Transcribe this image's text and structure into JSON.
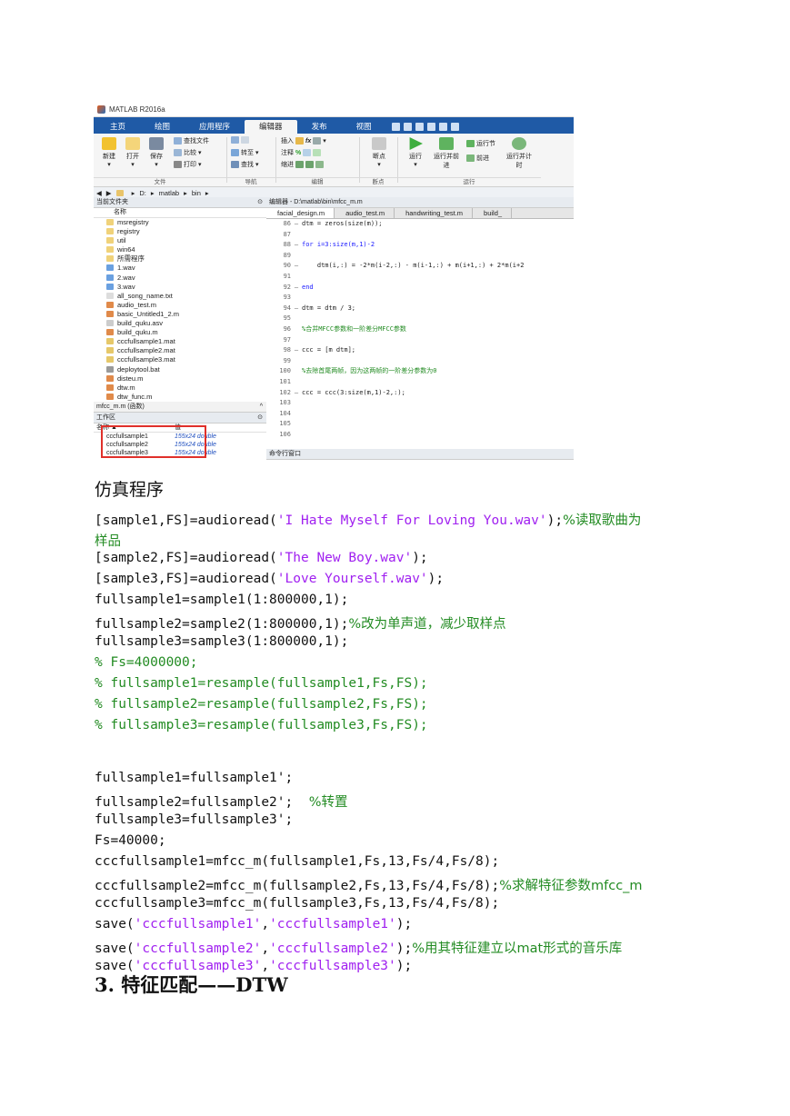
{
  "matlab": {
    "window_title": "MATLAB R2016a",
    "tabs": [
      "主页",
      "绘图",
      "应用程序",
      "编辑器",
      "发布",
      "视图"
    ],
    "active_tab": "编辑器",
    "ribbon": {
      "new": "新建",
      "open": "打开",
      "save": "保存",
      "find_files": "查找文件",
      "compare": "比较",
      "print": "打印",
      "goto": "转至",
      "find": "查找",
      "insert": "插入",
      "comment": "注释",
      "indent": "缩进",
      "breakpoints": "断点",
      "run": "运行",
      "run_advance": "运行并前进",
      "run_section": "运行节",
      "advance": "前进",
      "run_time": "运行并计时",
      "sections": {
        "file": "文件",
        "nav": "导航",
        "edit": "编辑",
        "breakpoints": "断点",
        "run": "运行"
      }
    },
    "path": [
      "D:",
      "matlab",
      "bin"
    ],
    "current_folder": {
      "title": "当前文件夹",
      "col_name": "名称",
      "items": [
        "msregistry",
        "registry",
        "util",
        "win64",
        "所需程序",
        "1.wav",
        "2.wav",
        "3.wav",
        "all_song_name.txt",
        "audio_test.m",
        "basic_Untitled1_2.m",
        "build_quku.asv",
        "build_quku.m",
        "cccfullsample1.mat",
        "cccfullsample2.mat",
        "cccfullsample3.mat",
        "deploytool.bat",
        "disteu.m",
        "dtw.m",
        "dtw_func.m"
      ],
      "detail": "mfcc_m.m (函数)"
    },
    "workspace": {
      "title": "工作区",
      "col_name": "名称 ▲",
      "col_value": "值",
      "rows": [
        {
          "name": "cccfullsample1",
          "value": "155x24 double"
        },
        {
          "name": "cccfullsample2",
          "value": "155x24 double"
        },
        {
          "name": "cccfullsample3",
          "value": "155x24 double"
        }
      ]
    },
    "editor": {
      "title": "编辑器 - D:\\matlab\\bin\\mfcc_m.m",
      "tabs": [
        "facial_design.m",
        "audio_test.m",
        "handwriting_test.m",
        "build_"
      ],
      "lines": [
        {
          "n": "86",
          "d": "—",
          "t": "dtm = zeros(size(m));"
        },
        {
          "n": "87",
          "d": "",
          "t": ""
        },
        {
          "n": "88",
          "d": "—",
          "t": "for i=3:size(m,1)-2"
        },
        {
          "n": "89",
          "d": "",
          "t": ""
        },
        {
          "n": "90",
          "d": "—",
          "t": "    dtm(i,:) = -2*m(i-2,:) - m(i-1,:) + m(i+1,:) + 2*m(i+2"
        },
        {
          "n": "91",
          "d": "",
          "t": ""
        },
        {
          "n": "92",
          "d": "—",
          "t": "end"
        },
        {
          "n": "93",
          "d": "",
          "t": ""
        },
        {
          "n": "94",
          "d": "—",
          "t": "dtm = dtm / 3;"
        },
        {
          "n": "95",
          "d": "",
          "t": ""
        },
        {
          "n": "96",
          "d": "",
          "t": "%合并MFCC参数和一阶差分MFCC参数"
        },
        {
          "n": "97",
          "d": "",
          "t": ""
        },
        {
          "n": "98",
          "d": "—",
          "t": "ccc = [m dtm];"
        },
        {
          "n": "99",
          "d": "",
          "t": ""
        },
        {
          "n": "100",
          "d": "",
          "t": "%去除首尾两帧，因为这两帧的一阶差分参数为0"
        },
        {
          "n": "101",
          "d": "",
          "t": ""
        },
        {
          "n": "102",
          "d": "—",
          "t": "ccc = ccc(3:size(m,1)-2,:);"
        },
        {
          "n": "103",
          "d": "",
          "t": ""
        },
        {
          "n": "104",
          "d": "",
          "t": ""
        },
        {
          "n": "105",
          "d": "",
          "t": ""
        },
        {
          "n": "106",
          "d": "",
          "t": ""
        }
      ],
      "command_window": "命令行窗口"
    }
  },
  "doc": {
    "heading": "仿真程序",
    "code": [
      [
        {
          "t": "[sample1,FS]=audioread("
        },
        {
          "t": "'I Hate Myself For Loving You.wav'",
          "c": "str"
        },
        {
          "t": ");"
        },
        {
          "t": "%读取歌曲为",
          "c": "com"
        }
      ],
      [
        {
          "t": "样品",
          "c": "com"
        }
      ],
      [
        {
          "t": "[sample2,FS]=audioread("
        },
        {
          "t": "'The New Boy.wav'",
          "c": "str"
        },
        {
          "t": ");"
        }
      ],
      [
        {
          "t": "[sample3,FS]=audioread("
        },
        {
          "t": "'Love Yourself.wav'",
          "c": "str"
        },
        {
          "t": ");"
        }
      ],
      [
        {
          "t": "fullsample1=sample1(1:800000,1);"
        }
      ],
      [
        {
          "t": "fullsample2=sample2(1:800000,1);"
        },
        {
          "t": "%改为单声道，减少取样点",
          "c": "com"
        }
      ],
      [
        {
          "t": "fullsample3=sample3(1:800000,1);"
        }
      ],
      [
        {
          "t": "% Fs=4000000;",
          "c": "comm"
        }
      ],
      [
        {
          "t": "% fullsample1=resample(fullsample1,Fs,FS);",
          "c": "comm"
        }
      ],
      [
        {
          "t": "% fullsample2=resample(fullsample2,Fs,FS);",
          "c": "comm"
        }
      ],
      [
        {
          "t": "% fullsample3=resample(fullsample3,Fs,FS);",
          "c": "comm"
        }
      ],
      [],
      [
        {
          "t": "fullsample1=fullsample1';"
        }
      ],
      [
        {
          "t": "fullsample2=fullsample2';  "
        },
        {
          "t": "%转置",
          "c": "com"
        }
      ],
      [
        {
          "t": "fullsample3=fullsample3';"
        }
      ],
      [
        {
          "t": "Fs=40000;"
        }
      ],
      [
        {
          "t": "cccfullsample1=mfcc_m(fullsample1,Fs,13,Fs/4,Fs/8);"
        }
      ],
      [
        {
          "t": "cccfullsample2=mfcc_m(fullsample2,Fs,13,Fs/4,Fs/8);"
        },
        {
          "t": "%求解特征参数mfcc_m",
          "c": "com"
        }
      ],
      [
        {
          "t": "cccfullsample3=mfcc_m(fullsample3,Fs,13,Fs/4,Fs/8);"
        }
      ],
      [
        {
          "t": "save("
        },
        {
          "t": "'cccfullsample1'",
          "c": "str"
        },
        {
          "t": ","
        },
        {
          "t": "'cccfullsample1'",
          "c": "str"
        },
        {
          "t": ");"
        }
      ],
      [
        {
          "t": "save("
        },
        {
          "t": "'cccfullsample2'",
          "c": "str"
        },
        {
          "t": ","
        },
        {
          "t": "'cccfullsample2'",
          "c": "str"
        },
        {
          "t": ");"
        },
        {
          "t": "%用其特征建立以mat形式的音乐库",
          "c": "com"
        }
      ],
      [
        {
          "t": "save("
        },
        {
          "t": "'cccfullsample3'",
          "c": "str"
        },
        {
          "t": ","
        },
        {
          "t": "'cccfullsample3'",
          "c": "str"
        },
        {
          "t": ");"
        }
      ]
    ],
    "section3": "3.  特征匹配——DTW"
  }
}
